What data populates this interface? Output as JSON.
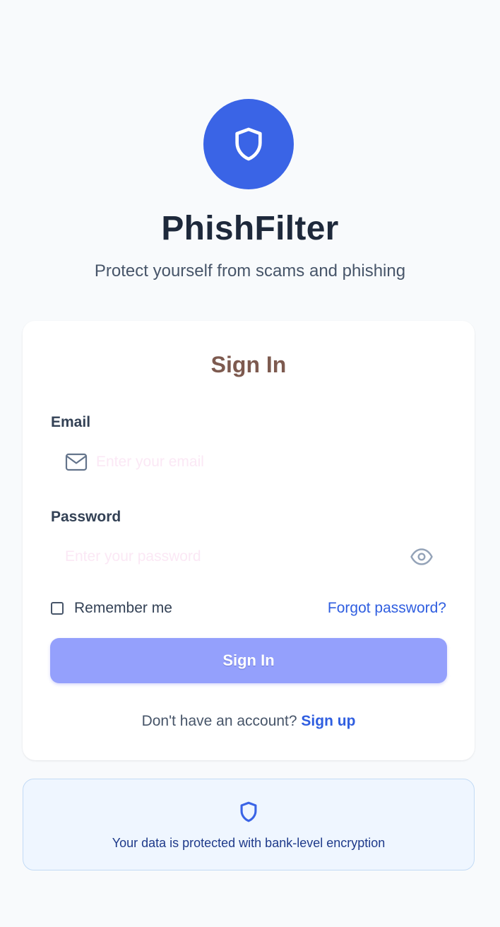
{
  "brand": {
    "name": "PhishFilter",
    "tagline": "Protect yourself from scams and phishing",
    "logo_icon": "shield-icon",
    "accent_color": "#3a64e6"
  },
  "form": {
    "title": "Sign In",
    "email": {
      "label": "Email",
      "placeholder": "Enter your email",
      "value": "",
      "icon": "mail-icon"
    },
    "password": {
      "label": "Password",
      "placeholder": "Enter your password",
      "value": "",
      "icon": "eye-icon"
    },
    "remember_label": "Remember me",
    "remember_checked": false,
    "forgot_label": "Forgot password?",
    "submit_label": "Sign In",
    "submit_color": "#94a0fc",
    "signup_prompt": "Don't have an account?",
    "signup_label": "Sign up"
  },
  "security_note": {
    "icon": "shield-icon",
    "text": "Your data is protected with bank-level encryption"
  }
}
